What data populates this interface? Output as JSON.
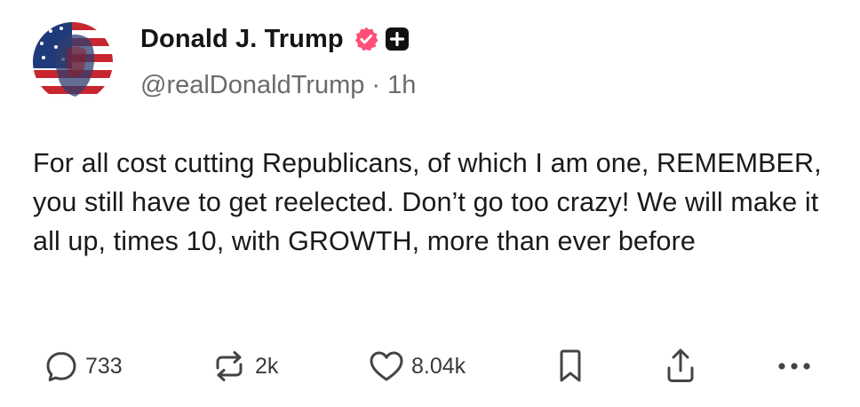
{
  "post": {
    "author": {
      "display_name": "Donald J. Trump",
      "handle": "@realDonaldTrump",
      "separator": "·",
      "time_ago": "1h",
      "verified_icon": "verified-badge-icon",
      "plus_icon": "plus-badge-icon"
    },
    "text": "For all cost cutting Republicans, of which I am one, REMEMBER, you still have to get reelected. Don’t go too crazy! We will make it all up, times 10, with GROWTH, more than ever before",
    "actions": {
      "reply_count": "733",
      "repost_count": "2k",
      "like_count": "8.04k"
    }
  },
  "colors": {
    "verified_badge": "#ff4f79",
    "text": "#1a1a1a",
    "muted": "#6b6b6b",
    "icon": "#444444"
  }
}
